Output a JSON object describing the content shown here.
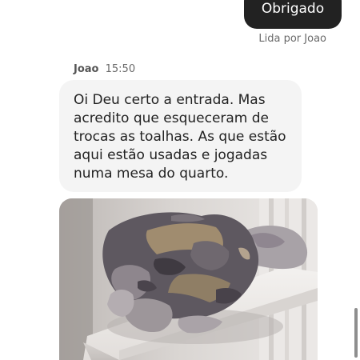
{
  "sent_message": {
    "text": "Obrigado",
    "read_receipt": "Lida por Joao"
  },
  "received_message": {
    "sender": "Joao",
    "time": "15:50",
    "text": "Oi Deu certo a entrada. Mas acredito que esqueceram de trocas as toalhas. As que estão aqui estão usadas e jogadas numa mesa do quarto."
  },
  "attachment": {
    "type": "photo",
    "icon": "towel-photo"
  },
  "colors": {
    "sent_bubble": "#222222",
    "received_bubble": "#f4f4f4",
    "meta_text": "#6a6a6a",
    "message_text": "#222222"
  }
}
